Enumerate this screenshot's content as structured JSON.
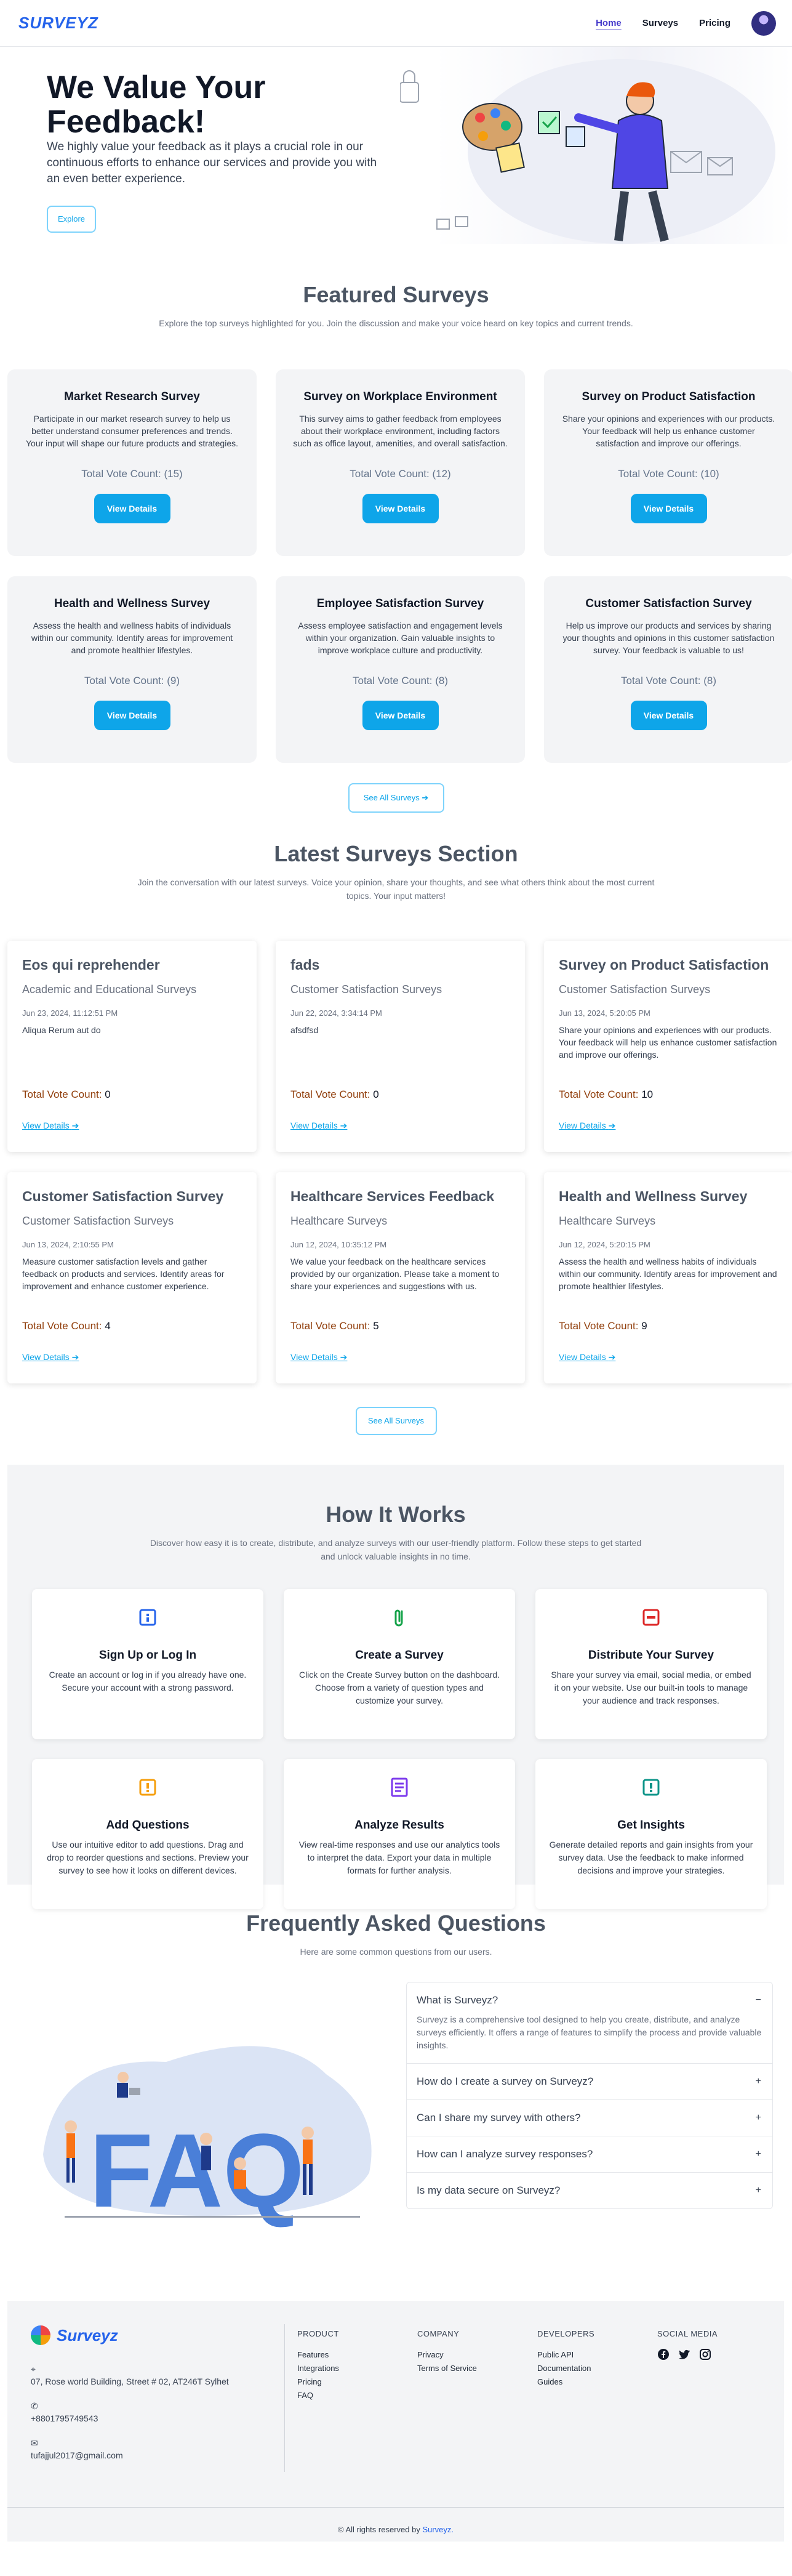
{
  "nav": {
    "logo": "SURVEYZ",
    "links": [
      "Home",
      "Surveys",
      "Pricing"
    ]
  },
  "hero": {
    "title": "We Value Your Feedback!",
    "text": "We highly value your feedback as it plays a crucial role in our continuous efforts to enhance our services and provide you with an even better experience.",
    "button": "Explore"
  },
  "featured": {
    "title": "Featured Surveys",
    "subtitle": "Explore the top surveys highlighted for you. Join the discussion and make your voice heard on key topics and current trends.",
    "button_label": "View Details",
    "cards": [
      {
        "title": "Market Research Survey",
        "desc": "Participate in our market research survey to help us better understand consumer preferences and trends. Your input will shape our future products and strategies.",
        "votes": "Total Vote Count: (15)"
      },
      {
        "title": "Survey on Workplace Environment",
        "desc": "This survey aims to gather feedback from employees about their workplace environment, including factors such as office layout, amenities, and overall satisfaction.",
        "votes": "Total Vote Count: (12)"
      },
      {
        "title": "Survey on Product Satisfaction",
        "desc": "Share your opinions and experiences with our products. Your feedback will help us enhance customer satisfaction and improve our offerings.",
        "votes": "Total Vote Count: (10)"
      },
      {
        "title": "Health and Wellness Survey",
        "desc": "Assess the health and wellness habits of individuals within our community. Identify areas for improvement and promote healthier lifestyles.",
        "votes": "Total Vote Count: (9)"
      },
      {
        "title": "Employee Satisfaction Survey",
        "desc": "Assess employee satisfaction and engagement levels within your organization. Gain valuable insights to improve workplace culture and productivity.",
        "votes": "Total Vote Count: (8)"
      },
      {
        "title": "Customer Satisfaction Survey",
        "desc": "Help us improve our products and services by sharing your thoughts and opinions in this customer satisfaction survey. Your feedback is valuable to us!",
        "votes": "Total Vote Count: (8)"
      }
    ],
    "see_all": "See All Surveys"
  },
  "latest": {
    "title": "Latest Surveys Section",
    "subtitle": "Join the conversation with our latest surveys. Voice your opinion, share your thoughts, and see what others think about the most current topics. Your input matters!",
    "vote_label": "Total Vote Count:",
    "link_label": "View Details",
    "cards": [
      {
        "title": "Eos qui reprehender",
        "category": "Academic and Educational Surveys",
        "date": "Jun 23, 2024, 11:12:51 PM",
        "desc": "Aliqua Rerum aut do",
        "votes": "0"
      },
      {
        "title": "fads",
        "category": "Customer Satisfaction Surveys",
        "date": "Jun 22, 2024, 3:34:14 PM",
        "desc": "afsdfsd",
        "votes": "0"
      },
      {
        "title": "Survey on Product Satisfaction",
        "category": "Customer Satisfaction Surveys",
        "date": "Jun 13, 2024, 5:20:05 PM",
        "desc": "Share your opinions and experiences with our products. Your feedback will help us enhance customer satisfaction and improve our offerings.",
        "votes": "10"
      },
      {
        "title": "Customer Satisfaction Survey",
        "category": "Customer Satisfaction Surveys",
        "date": "Jun 13, 2024, 2:10:55 PM",
        "desc": "Measure customer satisfaction levels and gather feedback on products and services. Identify areas for improvement and enhance customer experience.",
        "votes": "4"
      },
      {
        "title": "Healthcare Services Feedback",
        "category": "Healthcare Surveys",
        "date": "Jun 12, 2024, 10:35:12 PM",
        "desc": "We value your feedback on the healthcare services provided by our organization. Please take a moment to share your experiences and suggestions with us.",
        "votes": "5"
      },
      {
        "title": "Health and Wellness Survey",
        "category": "Healthcare Surveys",
        "date": "Jun 12, 2024, 5:20:15 PM",
        "desc": "Assess the health and wellness habits of individuals within our community. Identify areas for improvement and promote healthier lifestyles.",
        "votes": "9"
      }
    ],
    "see_all": "See All Surveys"
  },
  "how": {
    "title": "How It Works",
    "subtitle": "Discover how easy it is to create, distribute, and analyze surveys with our user-friendly platform. Follow these steps to get started and unlock valuable insights in no time.",
    "steps": [
      {
        "title": "Sign Up or Log In",
        "desc": "Create an account or log in if you already have one. Secure your account with a strong password.",
        "color": "#2563eb",
        "icon": "user-login-icon"
      },
      {
        "title": "Create a Survey",
        "desc": "Click on the Create Survey button on the dashboard. Choose from a variety of question types and customize your survey.",
        "color": "#16a34a",
        "icon": "paperclip-icon"
      },
      {
        "title": "Distribute Your Survey",
        "desc": "Share your survey via email, social media, or embed it on your website. Use our built-in tools to manage your audience and track responses.",
        "color": "#dc2626",
        "icon": "share-icon"
      },
      {
        "title": "Add Questions",
        "desc": "Use our intuitive editor to add questions. Drag and drop to reorder questions and sections. Preview your survey to see how it looks on different devices.",
        "color": "#f59e0b",
        "icon": "question-icon"
      },
      {
        "title": "Analyze Results",
        "desc": "View real-time responses and use our analytics tools to interpret the data. Export your data in multiple formats for further analysis.",
        "color": "#7c3aed",
        "icon": "document-icon"
      },
      {
        "title": "Get Insights",
        "desc": "Generate detailed reports and gain insights from your survey data. Use the feedback to make informed decisions and improve your strategies.",
        "color": "#0d9488",
        "icon": "insights-icon"
      }
    ]
  },
  "faq": {
    "title": "Frequently Asked Questions",
    "subtitle": "Here are some common questions from our users.",
    "items": [
      {
        "q": "What is Surveyz?",
        "a": "Surveyz is a comprehensive tool designed to help you create, distribute, and analyze surveys efficiently. It offers a range of features to simplify the process and provide valuable insights.",
        "sign": "−"
      },
      {
        "q": "How do I create a survey on Surveyz?",
        "sign": "+"
      },
      {
        "q": "Can I share my survey with others?",
        "sign": "+"
      },
      {
        "q": "How can I analyze survey responses?",
        "sign": "+"
      },
      {
        "q": "Is my data secure on Surveyz?",
        "sign": "+"
      }
    ]
  },
  "footer": {
    "brand": "Surveyz",
    "address": "07, Rose world Building, Street # 02, AT246T Sylhet",
    "phone": "+8801795749543",
    "email": "tufajjul2017@gmail.com",
    "cols": [
      {
        "title": "PRODUCT",
        "links": [
          "Features",
          "Integrations",
          "Pricing",
          "FAQ"
        ]
      },
      {
        "title": "COMPANY",
        "links": [
          "Privacy",
          "Terms of Service"
        ]
      },
      {
        "title": "DEVELOPERS",
        "links": [
          "Public API",
          "Documentation",
          "Guides"
        ]
      }
    ],
    "social_title": "SOCIAL MEDIA",
    "copyright": "© All rights reserved by",
    "copyright_brand": "Surveyz."
  }
}
